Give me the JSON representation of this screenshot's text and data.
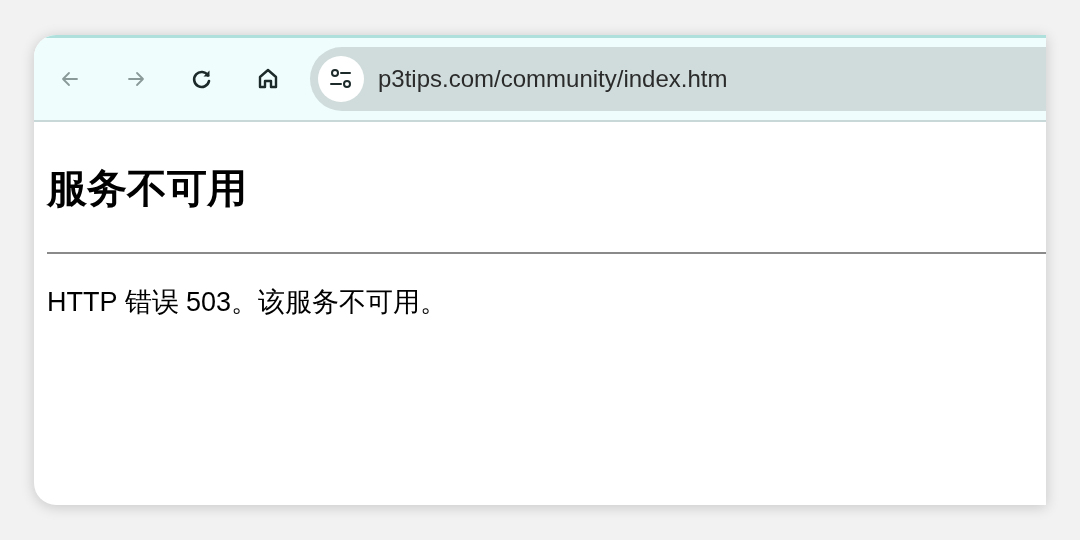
{
  "toolbar": {
    "buttons": [
      {
        "kind": "back",
        "disabled": true
      },
      {
        "kind": "forward",
        "disabled": true
      },
      {
        "kind": "reload",
        "disabled": false
      },
      {
        "kind": "home",
        "disabled": false
      }
    ],
    "address_bar": {
      "value": "p3tips.com/community/index.htm"
    }
  },
  "page": {
    "heading": "服务不可用",
    "message": "HTTP 错误 503。该服务不可用。"
  }
}
